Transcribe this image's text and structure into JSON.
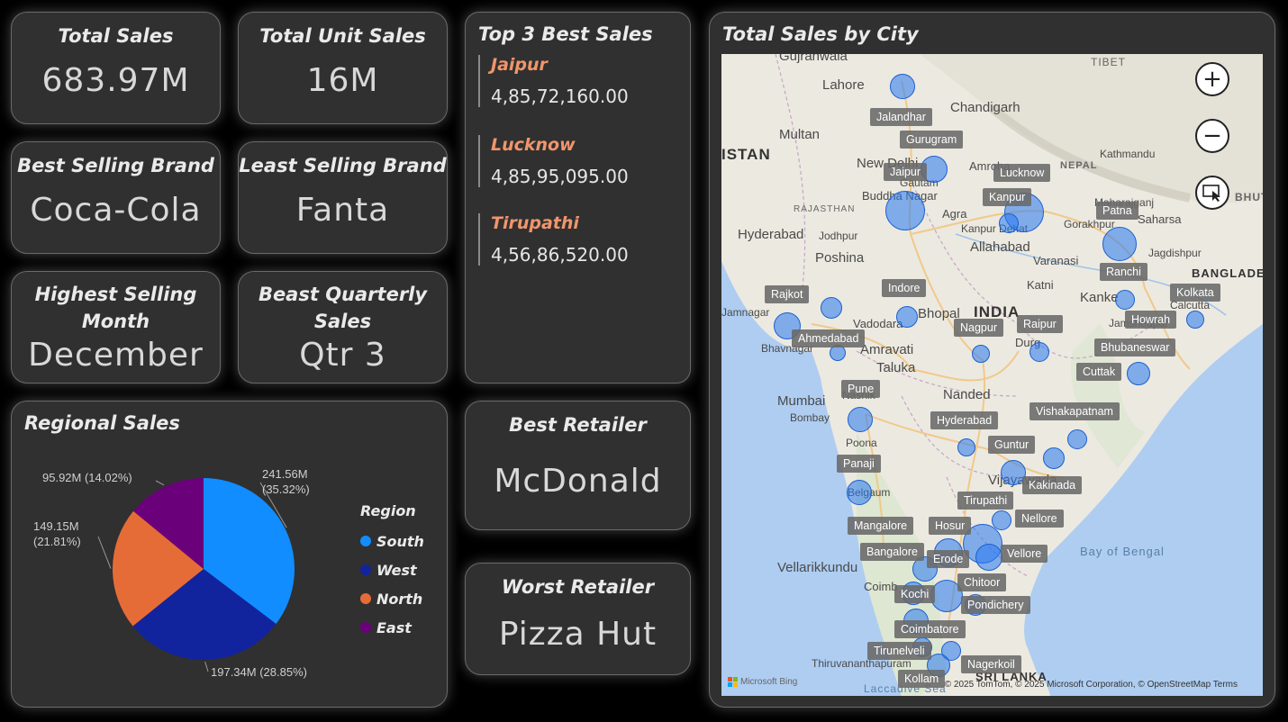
{
  "kpis": {
    "total_sales": {
      "title": "Total Sales",
      "value": "683.97M"
    },
    "total_unit_sales": {
      "title": "Total Unit Sales",
      "value": "16M"
    },
    "best_brand": {
      "title": "Best Selling Brand",
      "value": "Coca-Cola"
    },
    "least_brand": {
      "title": "Least Selling Brand",
      "value": "Fanta"
    },
    "highest_month": {
      "title_line1": "Highest Selling",
      "title_line2": "Month",
      "value": "December"
    },
    "best_quarter": {
      "title_line1": "Beast Quarterly",
      "title_line2": "Sales",
      "value": "Qtr 3"
    }
  },
  "top3": {
    "title": "Top 3 Best Sales",
    "items": [
      {
        "city": "Jaipur",
        "value": "4,85,72,160.00"
      },
      {
        "city": "Lucknow",
        "value": "4,85,95,095.00"
      },
      {
        "city": "Tirupathi",
        "value": "4,56,86,520.00"
      }
    ]
  },
  "retailers": {
    "best": {
      "title": "Best Retailer",
      "value": "McDonald"
    },
    "worst": {
      "title": "Worst Retailer",
      "value": "Pizza Hut"
    }
  },
  "regional": {
    "title": "Regional Sales",
    "legend_title": "Region",
    "labels": {
      "south": [
        "241.56M",
        "(35.32%)"
      ],
      "west": "197.34M (28.85%)",
      "north": [
        "149.15M",
        "(21.81%)"
      ],
      "east": "95.92M (14.02%)"
    },
    "colors": {
      "South": "#118dff",
      "West": "#12239e",
      "North": "#e66c37",
      "East": "#6b007b"
    }
  },
  "chart_data": {
    "type": "pie",
    "title": "Regional Sales",
    "categories": [
      "South",
      "West",
      "North",
      "East"
    ],
    "values": [
      241.56,
      197.34,
      149.15,
      95.92
    ],
    "percentages": [
      35.32,
      28.85,
      21.81,
      14.02
    ],
    "unit": "M",
    "legend_position": "right"
  },
  "map": {
    "title": "Total Sales by City",
    "attribution": "© 2025 TomTom, © 2025 Microsoft Corporation, © OpenStreetMap   Terms",
    "logo": "Microsoft Bing",
    "zoom_in": "+",
    "zoom_out": "−",
    "city_tags": [
      "Jalandhar",
      "Gurugram",
      "Jaipur",
      "Lucknow",
      "Kanpur",
      "Patna",
      "Ranchi",
      "Kolkata",
      "Howrah",
      "Bhubaneswar",
      "Cuttak",
      "Rajkot",
      "Ahmedabad",
      "Indore",
      "Nagpur",
      "Raipur",
      "Pune",
      "Hyderabad",
      "Vishakapatnam",
      "Guntur",
      "Panaji",
      "Kakinada",
      "Tirupathi",
      "Nellore",
      "Mangalore",
      "Hosur",
      "Bangalore",
      "Erode",
      "Vellore",
      "Chitoor",
      "Kochi",
      "Pondichery",
      "Coimbatore",
      "Tirunelveli",
      "Nagerkoil",
      "Kollam"
    ],
    "place_names": [
      "Gujranwala",
      "Lahore",
      "Chandigarh",
      "Multan",
      "ISTAN",
      "New Delhi",
      "Amroha",
      "NEPAL",
      "Kathmandu",
      "Buddha Nagar",
      "Gautam",
      "RAJASTHAN",
      "Agra",
      "Kanpur Dehat",
      "Maharajganj",
      "Gorakhpur",
      "Saharsa",
      "Hyderabad",
      "Jodhpur",
      "Allahabad",
      "Varanasi",
      "Jagdishpur",
      "Poshina",
      "Katni",
      "Kanke",
      "BANGLADE",
      "INDIA",
      "Bhopal",
      "Vadodara",
      "Bhavnagar",
      "Jamnagar",
      "Amravati",
      "Durg",
      "Taluka",
      "Mumbai",
      "Bombay",
      "Nashik",
      "Nanded",
      "Poona",
      "Belgaum",
      "Vijayawada",
      "Vellarikkundu",
      "Coimb",
      "Thiruvananthapuram",
      "SRI LANKA",
      "Laccadive Sea",
      "Bay of Bengal",
      "TIBET",
      "BHUTA",
      "Calcutta",
      "Jamshedpur"
    ]
  }
}
